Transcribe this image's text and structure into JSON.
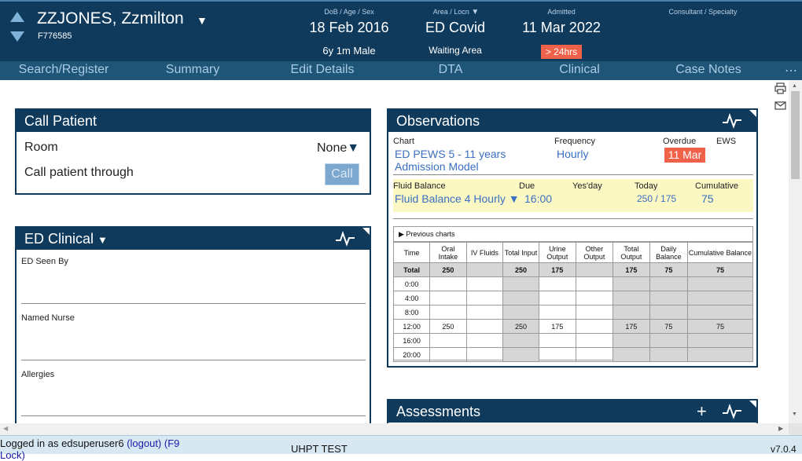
{
  "header": {
    "patient_name": "ZZJONES, Zzmilton",
    "patient_id": "F776585",
    "dob_label": "DoB / Age / Sex",
    "dob": "18 Feb 2016",
    "age_sex": "6y 1m Male",
    "area_label": "Area / Locn",
    "area": "ED Covid",
    "location": "Waiting Area",
    "admitted_label": "Admitted",
    "admitted": "11 Mar 2022",
    "admitted_badge": "> 24hrs",
    "consultant_label": "Consultant / Specialty",
    "badge_color": "#f0614a"
  },
  "tabs": [
    "Search/Register",
    "Summary",
    "Edit Details",
    "DTA",
    "Clinical",
    "Case Notes"
  ],
  "tabs_more": "⋯",
  "call_patient": {
    "title": "Call Patient",
    "room_label": "Room",
    "room_value": "None",
    "call_through_label": "Call patient through",
    "call_button": "Call"
  },
  "ed_clinical": {
    "title": "ED Clinical",
    "fields": [
      "ED Seen By",
      "Named Nurse",
      "Allergies"
    ]
  },
  "observations": {
    "title": "Observations",
    "chart_label": "Chart",
    "chart_value": "ED PEWS 5 - 11 years Admission Model",
    "frequency_label": "Frequency",
    "frequency_value": "Hourly",
    "overdue_label": "Overdue",
    "overdue_value": "11 Mar",
    "ews_label": "EWS",
    "fluid_label": "Fluid Balance",
    "fluid_value": "Fluid Balance 4 Hourly ▼",
    "due_label": "Due",
    "due_value": "16:00",
    "yesterday_label": "Yes'day",
    "today_label": "Today",
    "today_value": "250 / 175",
    "cumulative_label": "Cumulative",
    "cumulative_value": "75",
    "previous_charts": "▶ Previous charts",
    "table_headers": [
      "Time",
      "Oral Intake",
      "IV Fluids",
      "Total Input",
      "Urine Output",
      "Other Output",
      "Total Output",
      "Daily Balance",
      "Cumulative Balance"
    ],
    "table_rows": [
      [
        "Total",
        "250",
        "",
        "250",
        "175",
        "",
        "175",
        "75",
        "75"
      ],
      [
        "0:00",
        "",
        "",
        "",
        "",
        "",
        "",
        "",
        ""
      ],
      [
        "4:00",
        "",
        "",
        "",
        "",
        "",
        "",
        "",
        ""
      ],
      [
        "8:00",
        "",
        "",
        "",
        "",
        "",
        "",
        "",
        ""
      ],
      [
        "12:00",
        "250",
        "",
        "250",
        "175",
        "",
        "175",
        "75",
        "75"
      ],
      [
        "16:00",
        "",
        "",
        "",
        "",
        "",
        "",
        "",
        ""
      ],
      [
        "20:00",
        "",
        "",
        "",
        "",
        "",
        "",
        "",
        ""
      ]
    ]
  },
  "assessments": {
    "title": "Assessments",
    "add": "+"
  },
  "status": {
    "login_text": "Logged in as edsuperuser6",
    "logout": "(logout)",
    "lock": "(F9 Lock)",
    "env": "UHPT TEST",
    "version": "v7.0.4"
  },
  "icons": [
    "print-icon",
    "mail-icon",
    "activity-icon",
    "dropdown-icon"
  ]
}
